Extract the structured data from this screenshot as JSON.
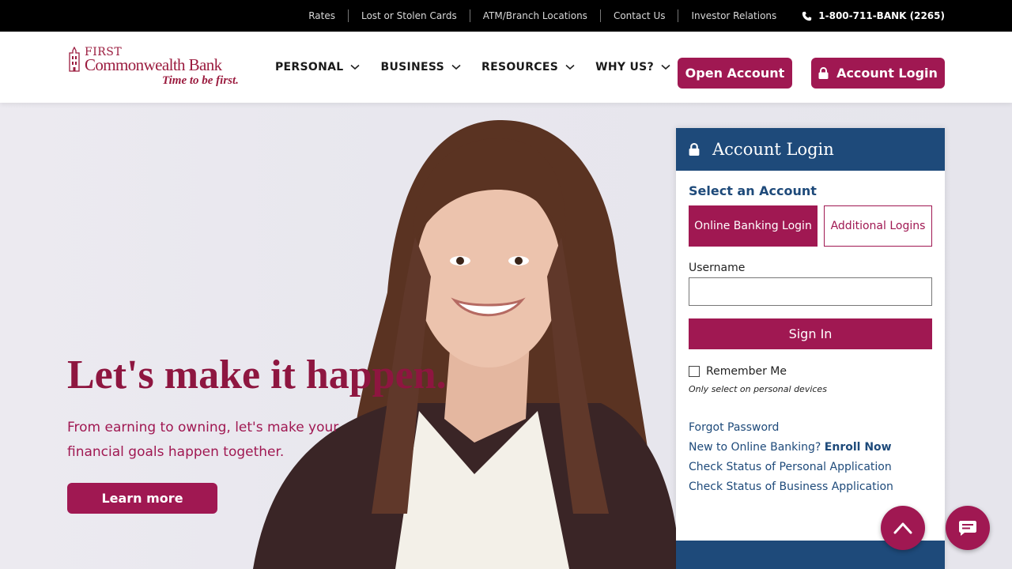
{
  "topbar": {
    "links": [
      "Rates",
      "Lost or Stolen Cards",
      "ATM/Branch Locations",
      "Contact Us",
      "Investor Relations"
    ],
    "phone": "1-800-711-BANK (2265)"
  },
  "logo": {
    "top": "FIRST",
    "main": "Commonwealth Bank",
    "tagline": "Time to be first."
  },
  "nav": {
    "items": [
      "PERSONAL",
      "BUSINESS",
      "RESOURCES",
      "WHY US?"
    ],
    "open_account": "Open Account",
    "account_login": "Account Login"
  },
  "hero": {
    "title": "Let's make it happen.",
    "subtitle": "From earning to owning, let's make your financial goals happen together.",
    "cta": "Learn more"
  },
  "login": {
    "title": "Account Login",
    "select_label": "Select an Account",
    "tabs": [
      "Online Banking Login",
      "Additional Logins"
    ],
    "username_label": "Username",
    "username_value": "",
    "signin": "Sign In",
    "remember": "Remember Me",
    "remember_note": "Only select on personal devices",
    "links": {
      "forgot": "Forgot Password",
      "new_prefix": "New to Online Banking?",
      "enroll": "Enroll Now",
      "personal_status": "Check Status of Personal Application",
      "business_status": "Check Status of Business Application"
    }
  },
  "colors": {
    "brand": "#a01852",
    "navy": "#1e4a7a",
    "topbar": "#000000"
  },
  "icons": [
    "phone-icon",
    "chevron-down-icon",
    "search-icon",
    "lock-icon",
    "arrow-up-icon",
    "chat-icon"
  ]
}
